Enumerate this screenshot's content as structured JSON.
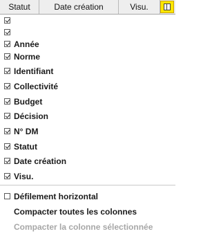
{
  "header": {
    "columns": [
      "Statut",
      "Date création",
      "Visu."
    ]
  },
  "menu": {
    "column_items": [
      {
        "label": "",
        "checked": true
      },
      {
        "label": "",
        "checked": true
      },
      {
        "label": "Année",
        "checked": true
      },
      {
        "label": "Norme",
        "checked": true
      },
      {
        "label": "Identifiant",
        "checked": true
      },
      {
        "label": "Collectivité",
        "checked": true
      },
      {
        "label": "Budget",
        "checked": true
      },
      {
        "label": "Décision",
        "checked": true
      },
      {
        "label": "N° DM",
        "checked": true
      },
      {
        "label": "Statut",
        "checked": true
      },
      {
        "label": "Date création",
        "checked": true
      },
      {
        "label": "Visu.",
        "checked": true
      }
    ],
    "horizontal_scroll_label": "Défilement horizontal",
    "compact_all_label": "Compacter toutes les colonnes",
    "compact_selected_label": "Compacter la colonne sélectionnée"
  }
}
